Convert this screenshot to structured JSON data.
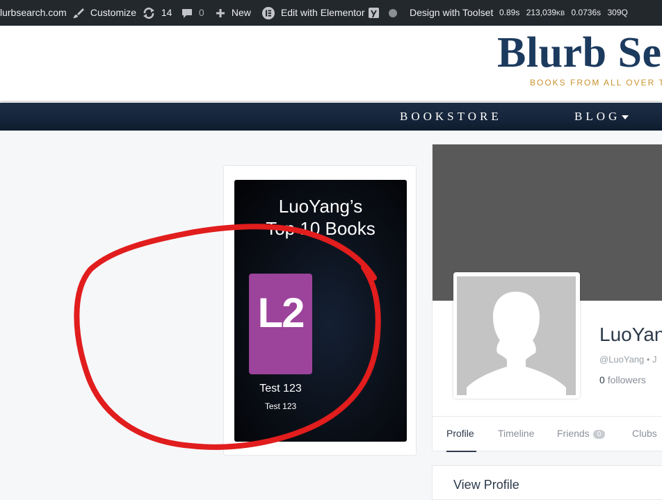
{
  "adminbar": {
    "site": "lurbsearch.com",
    "customize": "Customize",
    "updates_count": "14",
    "comments_count": "0",
    "new_label": "New",
    "elementor": "Edit with Elementor",
    "toolset": "Design with Toolset",
    "stat_time1": "0.89s",
    "stat_mem_value": "213,039",
    "stat_mem_unit": "KB",
    "stat_time2": "0.0736s",
    "stat_queries": "309Q"
  },
  "site": {
    "title": "Blurb Se",
    "tagline": "BOOKS FROM ALL OVER T"
  },
  "nav": {
    "bookstore": "BOOKSTORE",
    "blog": "BLOG"
  },
  "widget": {
    "title_line1": "LuoYang’s",
    "title_line2": "Top 10 Books",
    "cover_text": "L2",
    "book_title": "Test 123",
    "book_subtitle": "Test 123"
  },
  "profile": {
    "name": "LuoYan",
    "handle": "@LuoYang • J",
    "followers_count": "0",
    "followers_label": "followers",
    "tabs": {
      "profile": "Profile",
      "timeline": "Timeline",
      "friends": "Friends",
      "friends_count": "0",
      "clubs": "Clubs"
    },
    "view_profile": "View Profile"
  },
  "colors": {
    "adminbar_bg": "#23282d",
    "brand_navy": "#1c3a5e",
    "tagline_gold": "#c8932e",
    "cover_purple": "#9c439b",
    "annotation_red": "#e11d1d"
  },
  "icons": [
    "brush-icon",
    "refresh-icon",
    "comment-icon",
    "plus-icon",
    "elementor-icon",
    "yoast-icon",
    "status-dot-icon",
    "caret-down-icon",
    "avatar-placeholder-icon"
  ]
}
